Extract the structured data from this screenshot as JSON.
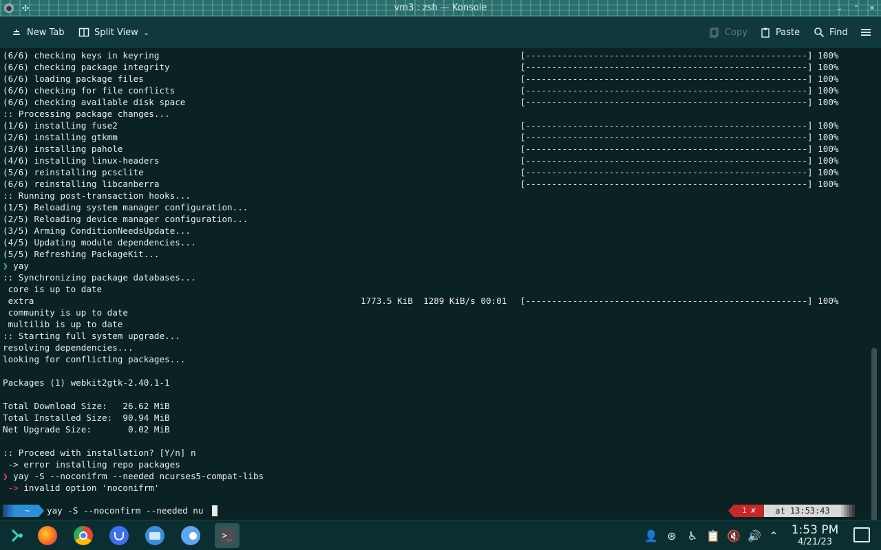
{
  "window": {
    "title": "vm3 : zsh — Konsole"
  },
  "toolbar": {
    "new_tab": "New Tab",
    "split_view": "Split View",
    "copy": "Copy",
    "paste": "Paste",
    "find": "Find"
  },
  "terminal": {
    "lines": [
      {
        "text": "(6/6) checking keys in keyring",
        "bar": "[------------------------------------------------------] 100%"
      },
      {
        "text": "(6/6) checking package integrity",
        "bar": "[------------------------------------------------------] 100%"
      },
      {
        "text": "(6/6) loading package files",
        "bar": "[------------------------------------------------------] 100%"
      },
      {
        "text": "(6/6) checking for file conflicts",
        "bar": "[------------------------------------------------------] 100%"
      },
      {
        "text": "(6/6) checking available disk space",
        "bar": "[------------------------------------------------------] 100%"
      },
      {
        "text": ":: Processing package changes..."
      },
      {
        "text": "(1/6) installing fuse2",
        "bar": "[------------------------------------------------------] 100%"
      },
      {
        "text": "(2/6) installing gtkmm",
        "bar": "[------------------------------------------------------] 100%"
      },
      {
        "text": "(3/6) installing pahole",
        "bar": "[------------------------------------------------------] 100%"
      },
      {
        "text": "(4/6) installing linux-headers",
        "bar": "[------------------------------------------------------] 100%"
      },
      {
        "text": "(5/6) reinstalling pcsclite",
        "bar": "[------------------------------------------------------] 100%"
      },
      {
        "text": "(6/6) reinstalling libcanberra",
        "bar": "[------------------------------------------------------] 100%"
      },
      {
        "text": ":: Running post-transaction hooks..."
      },
      {
        "text": "(1/5) Reloading system manager configuration..."
      },
      {
        "text": "(2/5) Reloading device manager configuration..."
      },
      {
        "text": "(3/5) Arming ConditionNeedsUpdate..."
      },
      {
        "text": "(4/5) Updating module dependencies..."
      },
      {
        "text": "(5/5) Refreshing PackageKit..."
      },
      {
        "prompt": "❯",
        "prompt_color": "green",
        "text": " yay"
      },
      {
        "text": ":: Synchronizing package databases..."
      },
      {
        "text": " core is up to date"
      },
      {
        "text": " extra",
        "mid": "1773.5 KiB  1289 KiB/s 00:01",
        "bar": "[------------------------------------------------------] 100%"
      },
      {
        "text": " community is up to date"
      },
      {
        "text": " multilib is up to date"
      },
      {
        "text": ":: Starting full system upgrade..."
      },
      {
        "text": "resolving dependencies..."
      },
      {
        "text": "looking for conflicting packages..."
      },
      {
        "text": ""
      },
      {
        "text": "Packages (1) webkit2gtk-2.40.1-1"
      },
      {
        "text": ""
      },
      {
        "text": "Total Download Size:   26.62 MiB"
      },
      {
        "text": "Total Installed Size:  90.94 MiB"
      },
      {
        "text": "Net Upgrade Size:       0.02 MiB"
      },
      {
        "text": ""
      },
      {
        "text": ":: Proceed with installation? [Y/n] n"
      },
      {
        "text": " -> error installing repo packages"
      },
      {
        "prompt": "❯",
        "prompt_color": "red",
        "text": " yay -S --noconifrm --needed ncurses5-compat-libs"
      },
      {
        "err": " ->",
        "text": " invalid option 'noconifrm'"
      }
    ]
  },
  "prompt": {
    "dir": "~",
    "command": "yay -S --noconfirm --needed nu",
    "status": "1 ✘",
    "time": "at 13:53:43"
  },
  "taskbar": {
    "apps": [
      "app-launcher",
      "firefox",
      "chrome",
      "bitwarden",
      "files",
      "settings",
      "konsole"
    ],
    "clock_time": "1:53 PM",
    "clock_date": "4/21/23"
  },
  "colors": {
    "terminal_bg": "#0b2224",
    "toolbar_bg": "#10393d",
    "prompt_dir": "#2b8fd8",
    "prompt_error": "#c62828"
  }
}
